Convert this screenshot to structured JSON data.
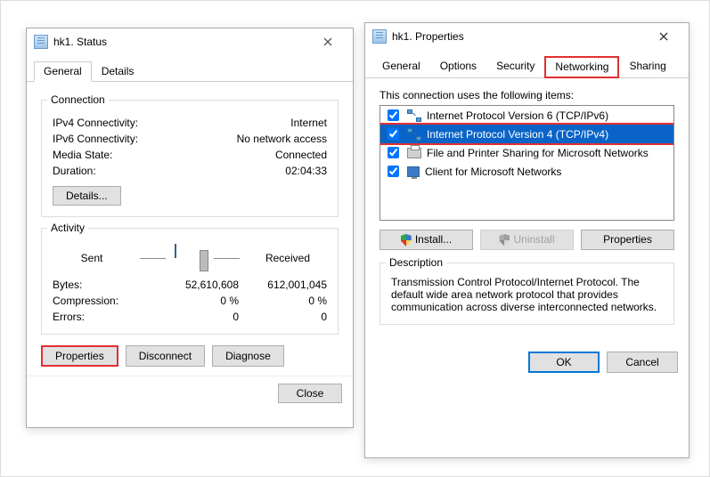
{
  "status_window": {
    "title": "hk1. Status",
    "tabs": {
      "general": "General",
      "details": "Details"
    },
    "connection": {
      "legend": "Connection",
      "ipv4_label": "IPv4 Connectivity:",
      "ipv4_value": "Internet",
      "ipv6_label": "IPv6 Connectivity:",
      "ipv6_value": "No network access",
      "media_label": "Media State:",
      "media_value": "Connected",
      "duration_label": "Duration:",
      "duration_value": "02:04:33",
      "details_btn": "Details..."
    },
    "activity": {
      "legend": "Activity",
      "sent_label": "Sent",
      "received_label": "Received",
      "bytes_label": "Bytes:",
      "bytes_sent": "52,610,608",
      "bytes_recv": "612,001,045",
      "compression_label": "Compression:",
      "compression_sent": "0 %",
      "compression_recv": "0 %",
      "errors_label": "Errors:",
      "errors_sent": "0",
      "errors_recv": "0"
    },
    "buttons": {
      "properties": "Properties",
      "disconnect": "Disconnect",
      "diagnose": "Diagnose",
      "close": "Close"
    }
  },
  "props_window": {
    "title": "hk1. Properties",
    "tabs": {
      "general": "General",
      "options": "Options",
      "security": "Security",
      "networking": "Networking",
      "sharing": "Sharing"
    },
    "list_label": "This connection uses the following items:",
    "items": [
      {
        "label": "Internet Protocol Version 6 (TCP/IPv6)",
        "checked": true,
        "selected": false,
        "icon": "net"
      },
      {
        "label": "Internet Protocol Version 4 (TCP/IPv4)",
        "checked": true,
        "selected": true,
        "icon": "net"
      },
      {
        "label": "File and Printer Sharing for Microsoft Networks",
        "checked": true,
        "selected": false,
        "icon": "prn"
      },
      {
        "label": "Client for Microsoft Networks",
        "checked": true,
        "selected": false,
        "icon": "cli"
      }
    ],
    "buttons": {
      "install": "Install...",
      "uninstall": "Uninstall",
      "properties": "Properties",
      "ok": "OK",
      "cancel": "Cancel"
    },
    "description": {
      "legend": "Description",
      "text": "Transmission Control Protocol/Internet Protocol. The default wide area network protocol that provides communication across diverse interconnected networks."
    }
  }
}
